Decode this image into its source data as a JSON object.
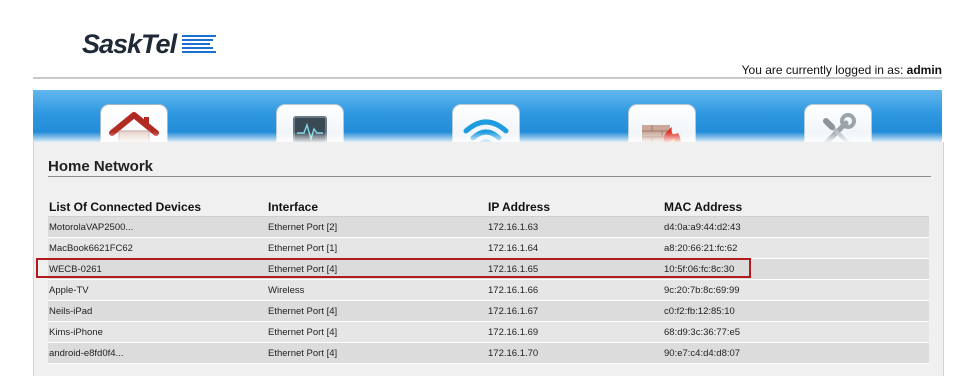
{
  "brand": {
    "name": "SaskTel",
    "accent": "#1a6fd1"
  },
  "header": {
    "login_prefix": "You are currently logged in as:",
    "username": "admin"
  },
  "nav": {
    "tabs": [
      {
        "icon": "home-icon",
        "active": true
      },
      {
        "icon": "monitor-icon",
        "active": false
      },
      {
        "icon": "wireless-icon",
        "active": false
      },
      {
        "icon": "firewall-icon",
        "active": false
      },
      {
        "icon": "tools-icon",
        "active": false
      }
    ]
  },
  "panel": {
    "title": "Home Network"
  },
  "table": {
    "headers": [
      "List Of Connected Devices",
      "Interface",
      "IP Address",
      "MAC Address"
    ],
    "rows": [
      [
        "MotorolaVAP2500...",
        "Ethernet Port [2]",
        "172.16.1.63",
        "d4:0a:a9:44:d2:43"
      ],
      [
        "MacBook6621FC62",
        "Ethernet Port [1]",
        "172.16.1.64",
        "a8:20:66:21:fc:62"
      ],
      [
        "WECB-0261",
        "Ethernet Port [4]",
        "172.16.1.65",
        "10:5f:06:fc:8c:30"
      ],
      [
        "Apple-TV",
        "Wireless",
        "172.16.1.66",
        "9c:20:7b:8c:69:99"
      ],
      [
        "Neils-iPad",
        "Ethernet Port [4]",
        "172.16.1.67",
        "c0:f2:fb:12:85:10"
      ],
      [
        "Kims-iPhone",
        "Ethernet Port [4]",
        "172.16.1.69",
        "68:d9:3c:36:77:e5"
      ],
      [
        "android-e8fd0f4...",
        "Ethernet Port [4]",
        "172.16.1.70",
        "90:e7:c4:d4:d8:07"
      ]
    ],
    "highlighted_row": 2,
    "highlight_color": "#b01c1c"
  }
}
